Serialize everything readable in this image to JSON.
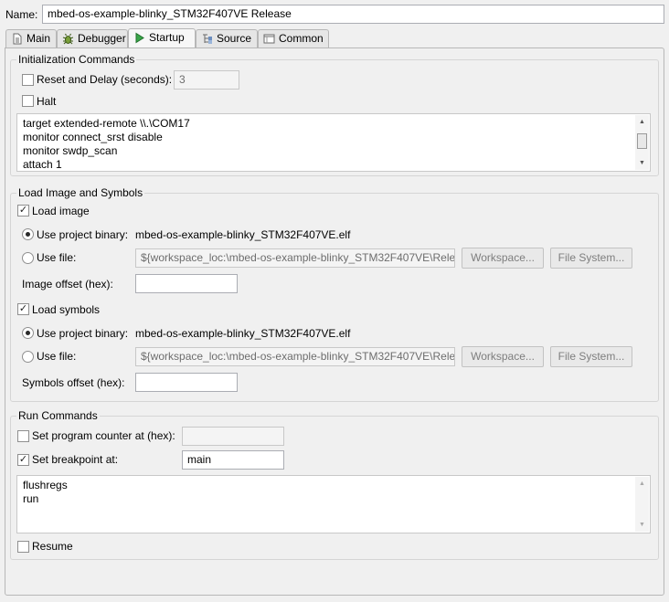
{
  "header": {
    "name_label": "Name:",
    "name_value": "mbed-os-example-blinky_STM32F407VE Release"
  },
  "tabs": [
    {
      "label": "Main",
      "icon": "document-icon"
    },
    {
      "label": "Debugger",
      "icon": "bug-icon"
    },
    {
      "label": "Startup",
      "icon": "play-icon",
      "active": true
    },
    {
      "label": "Source",
      "icon": "source-icon"
    },
    {
      "label": "Common",
      "icon": "window-icon"
    }
  ],
  "init": {
    "title": "Initialization Commands",
    "reset_label": "Reset and Delay (seconds):",
    "reset_checked": false,
    "delay_value": "3",
    "halt_label": "Halt",
    "halt_checked": false,
    "commands": [
      "target extended-remote \\\\.\\COM17",
      "monitor connect_srst disable",
      "monitor swdp_scan",
      "attach 1"
    ]
  },
  "load": {
    "title": "Load Image and Symbols",
    "load_image_label": "Load image",
    "load_image_checked": true,
    "image_project_label": "Use project binary:",
    "image_project_value": "mbed-os-example-blinky_STM32F407VE.elf",
    "image_file_label": "Use file:",
    "image_file_value": "${workspace_loc:\\mbed-os-example-blinky_STM32F407VE\\Release",
    "workspace_btn": "Workspace...",
    "filesystem_btn": "File System...",
    "image_offset_label": "Image offset (hex):",
    "image_offset_value": "",
    "load_symbols_label": "Load symbols",
    "load_symbols_checked": true,
    "symbols_project_label": "Use project binary:",
    "symbols_project_value": "mbed-os-example-blinky_STM32F407VE.elf",
    "symbols_file_label": "Use file:",
    "symbols_file_value": "${workspace_loc:\\mbed-os-example-blinky_STM32F407VE\\Release",
    "symbols_offset_label": "Symbols offset (hex):",
    "symbols_offset_value": ""
  },
  "run": {
    "title": "Run Commands",
    "set_pc_label": "Set program counter at (hex):",
    "set_pc_checked": false,
    "set_pc_value": "",
    "set_bp_label": "Set breakpoint at:",
    "set_bp_checked": true,
    "set_bp_value": "main",
    "commands": [
      "flushregs",
      "run"
    ],
    "resume_label": "Resume",
    "resume_checked": false
  }
}
